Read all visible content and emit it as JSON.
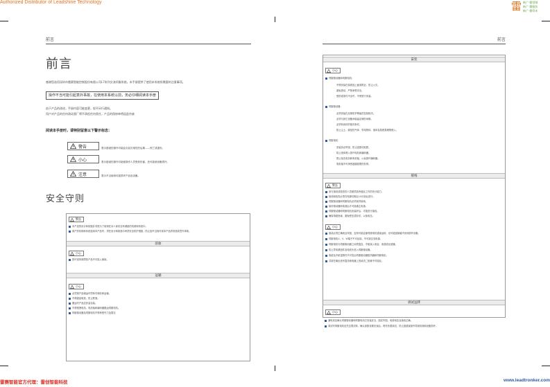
{
  "header": {
    "banner": "Authorized Distributor of Leadshine Technology",
    "logo_mark": "雷",
    "logo_lines": [
      "新广·雷领域",
      "新广·雷服务",
      "新广·雷伺未"
    ]
  },
  "left_page": {
    "running_head": "前言",
    "title": "前言",
    "intro_line": "感谢您选用深圳市雷赛智能控制股份有限公司L7系列交流伺服系统。本手册提供了使用本系统所需要的注意事项。",
    "boxed_note": "操作不当可能引起意外事故，在使用本系统以前，务必仔细阅读本手册",
    "para_lines": [
      "由于产品的改进，手册内容可能变更，恕不另行通知。",
      "用户对产品的任何改动我厂将不承担任何责任，产品的保修单将因此作废"
    ],
    "read_heading": "阅读本手册时，请特别留意以下警示标志：",
    "signs": [
      {
        "label": "警告",
        "desc": "表示错误的操作可能会引起灾难性的后果——死亡或重伤。"
      },
      {
        "label": "小心",
        "desc": "表示错误的操作可能使操作人员受到伤害，还可能使设备损坏。"
      },
      {
        "label": "注意",
        "desc": "表示不当使用可能损坏产品及设备。"
      }
    ],
    "safety_title": "安全守则",
    "panel": {
      "warn_label": "警告",
      "warn_items": [
        "本产品的设计和制造并非是为了使用在对人身安全有威胁的机械和系统中。",
        "用户的机械和系统选用本产品时，须在设计和制造中考虑安全防护措施，防止因不当操作或本产品异常造成意外事故。"
      ],
      "receive_bar": "验收",
      "receive_label": "小心",
      "receive_items": [
        "损坏或有故障的产品不可投入使用。"
      ],
      "transport_bar": "运输",
      "transport_label": "小心",
      "transport_items": [
        "必须按产品储运环境条件储存和运输。",
        "不得超高堆放，防止跌落。",
        "搬运时产品应妥善包装。",
        "不得拖拽电机、电机轴和编码器搬运伺服电机。",
        "伺服驱动器及伺服电机不得承受外力及撞击"
      ]
    }
  },
  "right_page": {
    "running_head": "前言",
    "install_bar": "安装",
    "install_label": "小心",
    "groups": [
      {
        "title": "伺服驱动器和伺服电机：",
        "lines": [
          "不得安装在易燃品上面或附近，防止火灾。",
          "避免振动，严禁承受冲击。",
          "受损或零件不全时，不得进行安装。"
        ]
      },
      {
        "title": "伺服驱动器：",
        "lines": [
          "必须安装在足够防护等级的控制柜内。",
          "必须与其它设备间保留足够的间隙。",
          "必须有良好的散热条件。",
          "防止尘土、腐蚀性气体、导电物体、液体及易燃易爆物侵入。"
        ]
      },
      {
        "title": "伺服电机：",
        "lines": [
          "安装务必牢固，防止因振动松脱。",
          "防止液体侵入损坏电机和编码器。",
          "禁止敲击电机和电机轴，以免损坏编码器。",
          "电机轴不可承受超越极限的负荷。"
        ]
      }
    ],
    "wiring_bar": "接线",
    "wiring_warn_label": "警告",
    "wiring_warn_items": [
      "参与接线或检查的人员都须具有做此工作的充分能力。",
      "接线和检查必须在电源切断后10分钟后进行。",
      "伺服驱动器和伺服电机必须良好接地。",
      "接好驱动器和电源后才可接通主电源。",
      "伺服驱动器和伺服电机安装好后，才能进行接线。",
      "确保电缆绝缘，避免受压或剪切，以免电击。"
    ],
    "wiring_care_label": "小心",
    "wiring_care_items": [
      "接线必须正确而且牢固，否则可能会使伺服电机错误运转，也可能因接触不良而损坏设备。",
      "伺服电机U、V、W端子不可反接，不可接交流电源。",
      "伺服电机与伺服驱动器之间须直连，不能接入电容、电感或滤波器。",
      "防止导电紧固件及电线头进入伺服驱动器。",
      "电缆及不耐温物件不可靠近伺服驱动器散热器和伺服电机。",
      "并接在输出信号直流继电器上的续流二极管不可接反。"
    ],
    "debug_bar": "调试运转",
    "debug_label": "小心",
    "debug_items": [
      "通电前应确认伺服驱动器和伺服电机已安装妥当，固定牢固，电源电压及接线正确。",
      "调试时伺服电机应先空载试转，确认参数设置无误后，再作负载调试，防止因错误操作导致机械和设备损坏。"
    ]
  },
  "footer": {
    "left": "雷赛智能官方代理：雷创智能科技",
    "right": "www.leadtronker.com"
  }
}
